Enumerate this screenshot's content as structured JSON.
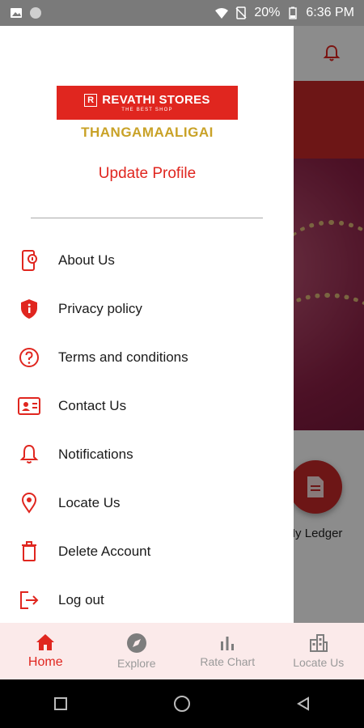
{
  "status_bar": {
    "battery": "20%",
    "time": "6:36 PM"
  },
  "background": {
    "fab_label": "My Ledger"
  },
  "drawer": {
    "logo_text": "REVATHI STORES",
    "logo_subtext": "THE BEST SHOP",
    "logo_tagline": "THANGAMAALIGAI",
    "update_profile": "Update Profile",
    "menu": [
      {
        "label": "About Us",
        "icon": "phone-info-icon"
      },
      {
        "label": "Privacy policy",
        "icon": "shield-icon"
      },
      {
        "label": "Terms and conditions",
        "icon": "help-circle-icon"
      },
      {
        "label": "Contact Us",
        "icon": "contact-card-icon"
      },
      {
        "label": "Notifications",
        "icon": "bell-icon"
      },
      {
        "label": "Locate Us",
        "icon": "location-pin-icon"
      },
      {
        "label": "Delete Account",
        "icon": "trash-icon"
      },
      {
        "label": "Log out",
        "icon": "logout-icon"
      }
    ]
  },
  "bottom_nav": {
    "items": [
      {
        "label": "Home",
        "icon": "home-icon",
        "active": true
      },
      {
        "label": "Explore",
        "icon": "compass-icon",
        "active": false
      },
      {
        "label": "Rate Chart",
        "icon": "bar-chart-icon",
        "active": false
      },
      {
        "label": "Locate Us",
        "icon": "buildings-icon",
        "active": false
      }
    ]
  },
  "colors": {
    "accent": "#e0261f",
    "gold": "#c9a227",
    "nav_bg": "#fbeaea"
  }
}
